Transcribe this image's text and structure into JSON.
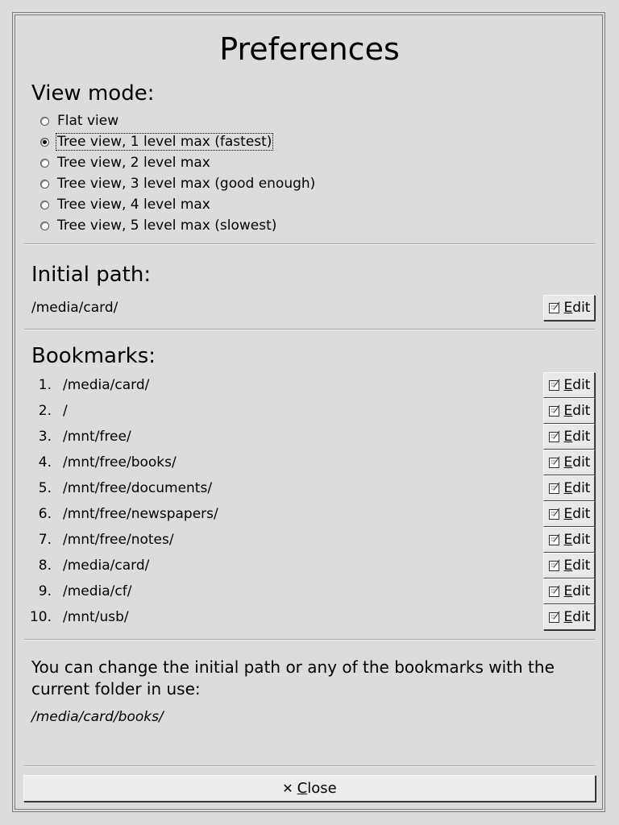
{
  "title": "Preferences",
  "view_mode": {
    "heading": "View mode:",
    "options": [
      {
        "label": "Flat view",
        "checked": false
      },
      {
        "label": "Tree view, 1 level max (fastest)",
        "checked": true
      },
      {
        "label": "Tree view, 2 level max",
        "checked": false
      },
      {
        "label": "Tree view, 3 level max (good enough)",
        "checked": false
      },
      {
        "label": "Tree view, 4 level max",
        "checked": false
      },
      {
        "label": "Tree view, 5 level max (slowest)",
        "checked": false
      }
    ]
  },
  "initial_path": {
    "heading": "Initial path:",
    "value": "/media/card/",
    "edit_label": "Edit"
  },
  "bookmarks": {
    "heading": "Bookmarks:",
    "edit_label": "Edit",
    "items": [
      {
        "num": "1.",
        "path": "/media/card/"
      },
      {
        "num": "2.",
        "path": "/"
      },
      {
        "num": "3.",
        "path": "/mnt/free/"
      },
      {
        "num": "4.",
        "path": "/mnt/free/books/"
      },
      {
        "num": "5.",
        "path": "/mnt/free/documents/"
      },
      {
        "num": "6.",
        "path": "/mnt/free/newspapers/"
      },
      {
        "num": "7.",
        "path": "/mnt/free/notes/"
      },
      {
        "num": "8.",
        "path": "/media/card/"
      },
      {
        "num": "9.",
        "path": "/media/cf/"
      },
      {
        "num": "10.",
        "path": "/mnt/usb/"
      }
    ]
  },
  "info": {
    "text": "You can change the initial path or any of the bookmarks with the current folder in use:",
    "current_path": "/media/card/books/"
  },
  "close_label": "Close"
}
